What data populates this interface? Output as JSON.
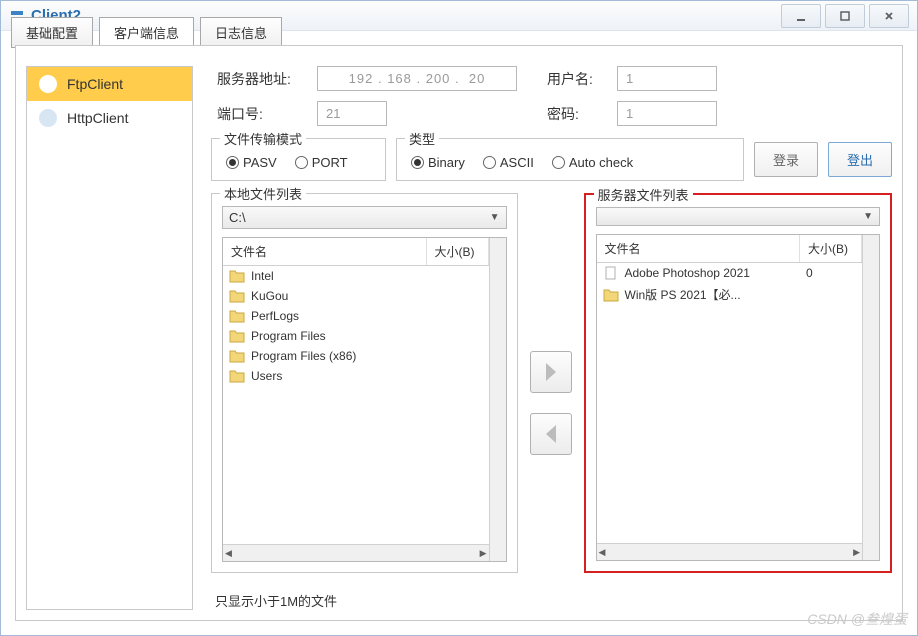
{
  "window": {
    "title": "Client2"
  },
  "tabs": {
    "tab1": "基础配置",
    "tab2": "客户端信息",
    "tab3": "日志信息"
  },
  "sidebar": {
    "items": [
      {
        "label": "FtpClient",
        "selected": true
      },
      {
        "label": "HttpClient",
        "selected": false
      }
    ]
  },
  "form": {
    "server_addr_label": "服务器地址:",
    "server_addr_value": "192 . 168 . 200 .  20",
    "port_label": "端口号:",
    "port_value": "21",
    "user_label": "用户名:",
    "user_value": "1",
    "pass_label": "密码:",
    "pass_value": "1"
  },
  "transfer_mode": {
    "title": "文件传输模式",
    "pasv": "PASV",
    "port": "PORT"
  },
  "type_mode": {
    "title": "类型",
    "binary": "Binary",
    "ascii": "ASCII",
    "auto": "Auto check"
  },
  "buttons": {
    "login": "登录",
    "logout": "登出"
  },
  "local_files": {
    "title": "本地文件列表",
    "drive": "C:\\",
    "col_name": "文件名",
    "col_size": "大小(B)",
    "items": [
      {
        "name": "Intel",
        "type": "folder"
      },
      {
        "name": "KuGou",
        "type": "folder"
      },
      {
        "name": "PerfLogs",
        "type": "folder"
      },
      {
        "name": "Program Files",
        "type": "folder"
      },
      {
        "name": "Program Files (x86)",
        "type": "folder"
      },
      {
        "name": "Users",
        "type": "folder"
      }
    ]
  },
  "server_files": {
    "title": "服务器文件列表",
    "drive": "",
    "col_name": "文件名",
    "col_size": "大小(B)",
    "items": [
      {
        "name": "Adobe Photoshop 2021",
        "size": "0",
        "type": "file"
      },
      {
        "name": "Win版 PS 2021【必...",
        "size": "",
        "type": "folder"
      }
    ]
  },
  "footer": {
    "filter_text": "只显示小于1M的文件"
  },
  "watermark": "CSDN @叁煌蛋"
}
